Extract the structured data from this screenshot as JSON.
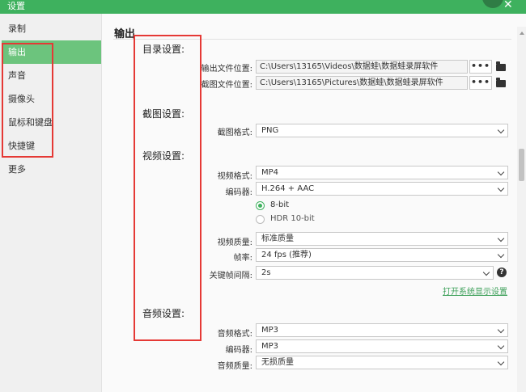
{
  "window": {
    "title": "设置",
    "close_glyph": "✕"
  },
  "sidebar": {
    "items": [
      {
        "label": "录制",
        "active": false
      },
      {
        "label": "输出",
        "active": true
      },
      {
        "label": "声音",
        "active": false
      },
      {
        "label": "摄像头",
        "active": false
      },
      {
        "label": "鼠标和键盘",
        "active": false
      },
      {
        "label": "快捷键",
        "active": false
      },
      {
        "label": "更多",
        "active": false
      }
    ]
  },
  "main": {
    "section_title": "输出",
    "groups": {
      "directory": "目录设置:",
      "screenshot": "截图设置:",
      "video": "视频设置:",
      "audio": "音频设置:"
    },
    "directory": {
      "output_label": "输出文件位置:",
      "output_path": "C:\\Users\\13165\\Videos\\数据蛙\\数据蛙录屏软件",
      "screenshot_label": "截图文件位置:",
      "screenshot_path": "C:\\Users\\13165\\Pictures\\数据蛙\\数据蛙录屏软件",
      "browse_label": "•••"
    },
    "screenshot": {
      "format_label": "截图格式:",
      "format_value": "PNG"
    },
    "video": {
      "format_label": "视频格式:",
      "format_value": "MP4",
      "encoder_label": "编码器:",
      "encoder_value": "H.264 + AAC",
      "bit8_label": "8-bit",
      "hdr_label": "HDR 10-bit",
      "quality_label": "视频质量:",
      "quality_value": "标准质量",
      "fps_label": "帧率:",
      "fps_value": "24 fps (推荐)",
      "keyframe_label": "关键帧间隔:",
      "keyframe_value": "2s",
      "help_glyph": "?",
      "display_link": "打开系统显示设置"
    },
    "audio": {
      "format_label": "音频格式:",
      "format_value": "MP3",
      "encoder_label": "编码器:",
      "encoder_value": "MP3",
      "quality_label": "音频质量:",
      "quality_value": "无损质量"
    }
  },
  "colors": {
    "accent": "#3eb15e",
    "sidebar_active": "#6cc47d",
    "annotation": "#e53935"
  }
}
